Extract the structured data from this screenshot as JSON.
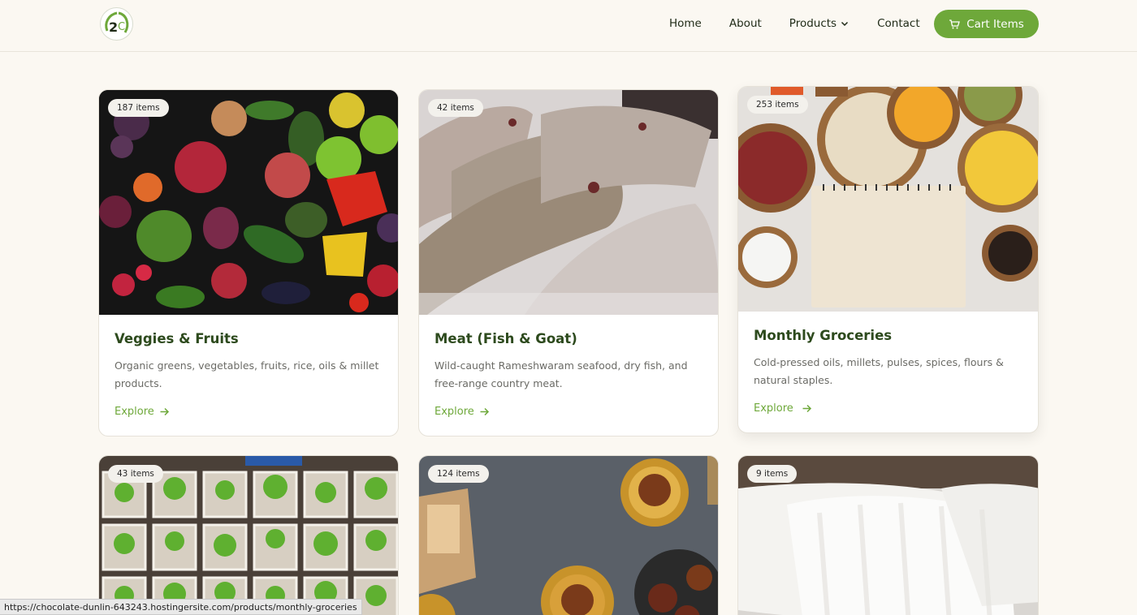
{
  "header": {
    "logo_alt": "logo",
    "nav": {
      "home": "Home",
      "about": "About",
      "products": "Products",
      "contact": "Contact"
    },
    "cart_label": "Cart Items"
  },
  "colors": {
    "accent": "#6ea83a",
    "title": "#2d4a1d",
    "background": "#fbf8f2"
  },
  "cards": [
    {
      "badge": "187 items",
      "title": "Veggies & Fruits",
      "desc": "Organic greens, vegetables, fruits, rice, oils & millet products.",
      "link": "Explore",
      "image": "vegetables-photo"
    },
    {
      "badge": "42 items",
      "title": "Meat (Fish & Goat)",
      "desc": "Wild-caught Rameshwaram seafood, dry fish, and free-range country meat.",
      "link": "Explore",
      "image": "fish-photo"
    },
    {
      "badge": "253 items",
      "title": "Monthly Groceries",
      "desc": "Cold-pressed oils, millets, pulses, spices, flours & natural staples.",
      "link": "Explore",
      "image": "groceries-photo"
    },
    {
      "badge": "43 items",
      "image": "seedlings-photo"
    },
    {
      "badge": "124 items",
      "image": "sweets-photo"
    },
    {
      "badge": "9 items",
      "image": "pillows-photo"
    }
  ],
  "status_bar": {
    "url": "https://chocolate-dunlin-643243.hostingersite.com/products/monthly-groceries"
  }
}
